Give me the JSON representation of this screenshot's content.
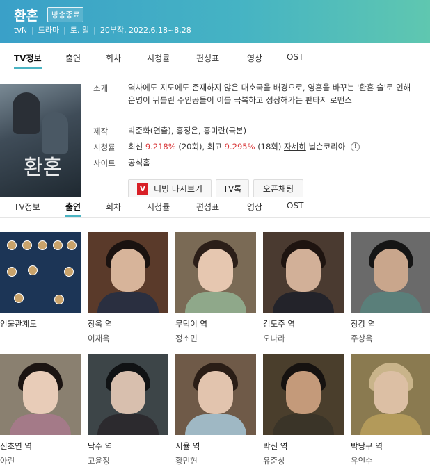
{
  "header": {
    "title": "환혼",
    "badge": "방송종료",
    "meta": [
      "tvN",
      "드라마",
      "토, 일",
      "20부작, 2022.6.18~8.28"
    ]
  },
  "tabs": [
    "TV정보",
    "출연",
    "회차",
    "시청률",
    "편성표",
    "영상",
    "OST"
  ],
  "tabs_active_top": "TV정보",
  "tabs_active_sticky": "출연",
  "info": {
    "intro_label": "소개",
    "intro_text": "역사에도 지도에도 존재하지 않은 대호국을 배경으로, 영혼을 바꾸는 '환혼 술'로 인해 운명이 뒤틀린 주인공들이 이를 극복하고 성장해가는 판타지 로맨스",
    "production_label": "제작",
    "production_text": "박준화(연출), 홍정은, 홍미란(극본)",
    "rating_label": "시청률",
    "rating_min_prefix": "최신",
    "rating_min_value": "9.218%",
    "rating_min_ep": "(20회),",
    "rating_max_prefix": "최고",
    "rating_max_value": "9.295%",
    "rating_max_ep": "(18회)",
    "rating_link": "자세히",
    "rating_source": "닐슨코리아",
    "site_label": "사이트",
    "site_text": "공식홈"
  },
  "poster": {
    "title": "환혼"
  },
  "buttons": {
    "tving": "티빙 다시보기",
    "tving_logo": "V",
    "tvtalk": "TV톡",
    "openchat": "오픈채팅"
  },
  "cast": [
    {
      "role": "인물관계도",
      "actor": ""
    },
    {
      "role": "장욱 역",
      "actor": "이재욱"
    },
    {
      "role": "무덕이 역",
      "actor": "정소민"
    },
    {
      "role": "김도주 역",
      "actor": "오나라"
    },
    {
      "role": "장강 역",
      "actor": "주상욱"
    },
    {
      "role": "진초연 역",
      "actor": "아린"
    },
    {
      "role": "낙수 역",
      "actor": "고윤정"
    },
    {
      "role": "서율 역",
      "actor": "황민현"
    },
    {
      "role": "박진 역",
      "actor": "유준상"
    },
    {
      "role": "박당구 역",
      "actor": "유인수"
    }
  ],
  "colors": {
    "header_start": "#3aa0c8",
    "header_end": "#5fc7b0",
    "accent": "#4ab3c2",
    "rating_red": "#d9383a"
  }
}
